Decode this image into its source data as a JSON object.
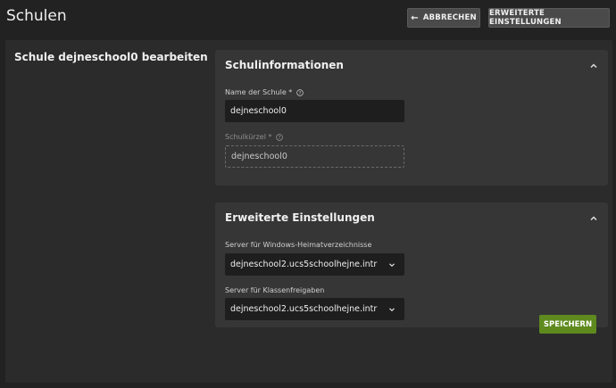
{
  "header": {
    "title": "Schulen",
    "cancel_label": "ABBRECHEN",
    "advanced_label": "ERWEITERTE EINSTELLUNGEN"
  },
  "form": {
    "title": "Schule dejneschool0 bearbeiten"
  },
  "school_info": {
    "title": "Schulinformationen",
    "name_label": "Name der Schule *",
    "name_value": "dejneschool0",
    "short_label": "Schulkürzel *",
    "short_value": "dejneschool0"
  },
  "advanced": {
    "title": "Erweiterte Einstellungen",
    "home_server_label": "Server für Windows-Heimatverzeichnisse",
    "home_server_value": "dejneschool2.ucs5schoolhejne.intr ...",
    "class_server_label": "Server für Klassenfreigaben",
    "class_server_value": "dejneschool2.ucs5schoolhejne.intr ..."
  },
  "footer": {
    "save_label": "SPEICHERN"
  },
  "colors": {
    "background": "#222222",
    "panel": "#2b2b2b",
    "section": "#363636",
    "input": "#1e1e1e",
    "save_button": "#5e8a1e"
  },
  "icons": {
    "back": "arrow-left-icon",
    "collapse": "chevron-up-icon",
    "help": "help-circle-icon",
    "dropdown": "chevron-down-icon"
  }
}
